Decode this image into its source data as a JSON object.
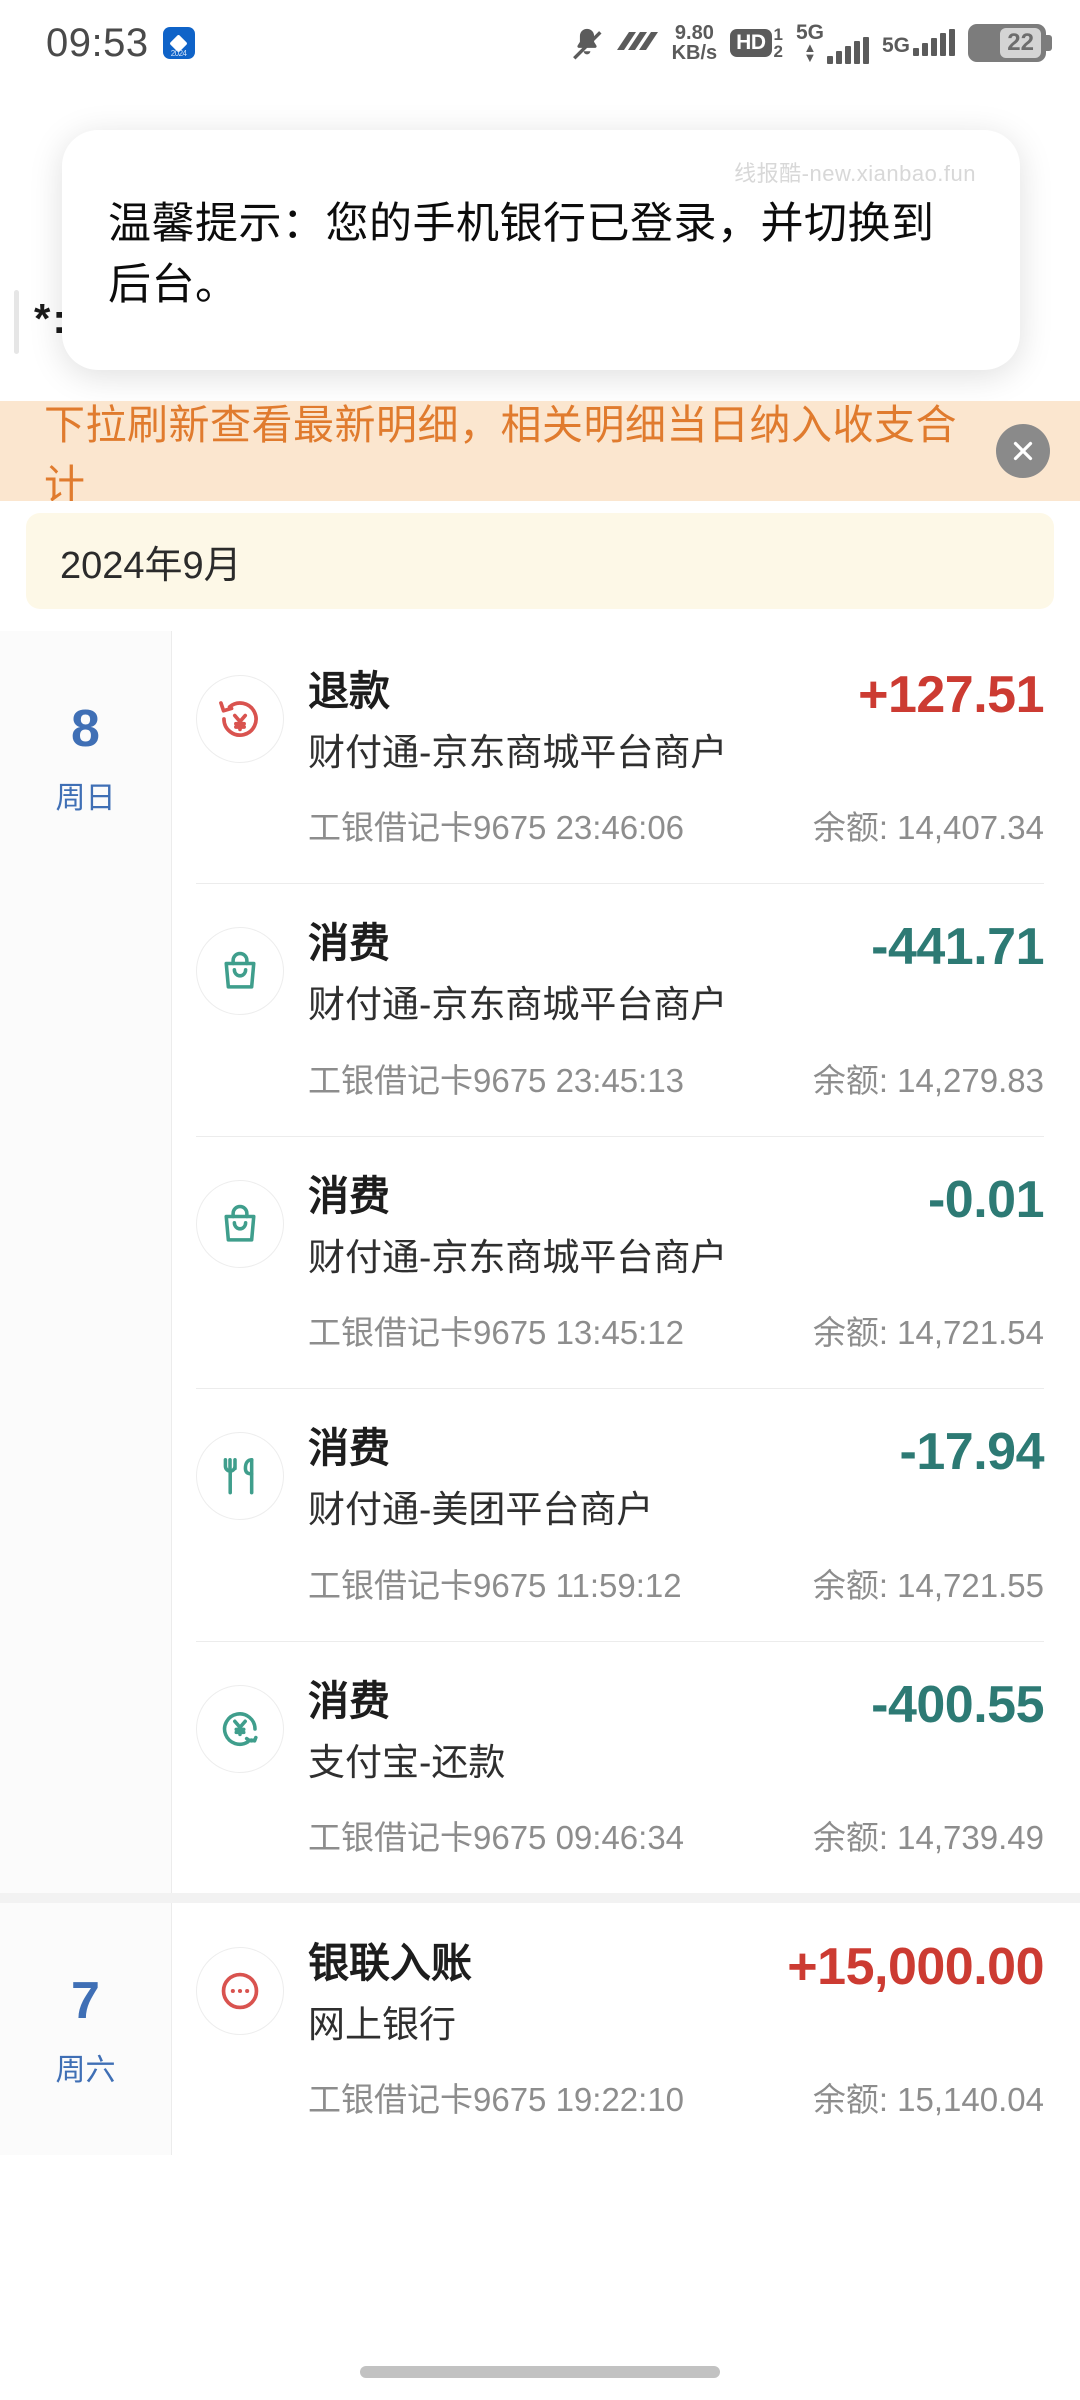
{
  "status_bar": {
    "clock": "09:53",
    "app_badge_label": "2024",
    "network_speed_value": "9.80",
    "network_speed_unit": "KB/s",
    "hd_label": "HD",
    "sim_slot_top": "1",
    "sim_slot_bottom": "2",
    "network_type_sim1": "5G",
    "network_type_sim2": "5G",
    "battery_percent": "22",
    "icons": [
      "mute-bell-icon",
      "vpn-arrows-icon",
      "hd-icon",
      "signal-icon",
      "signal-icon",
      "battery-icon"
    ]
  },
  "background_header": {
    "masked_text": "*:"
  },
  "toast": {
    "message": "温馨提示：您的手机银行已登录，并切换到后台。",
    "watermark": "线报酷-new.xianbao.fun"
  },
  "notice": {
    "text": "下拉刷新查看最新明细，相关明细当日纳入收支合计",
    "close_icon": "close-icon",
    "background_color": "#fbe6cf",
    "text_color": "#e07b2e"
  },
  "month_header": {
    "label": "2024年9月",
    "background_color": "#fdf8e7"
  },
  "colors": {
    "income": "#cc3b32",
    "expense": "#2d7a74",
    "date": "#3f6fb5"
  },
  "days": [
    {
      "day_number": "8",
      "weekday": "周日",
      "transactions": [
        {
          "icon": "refund-yen-icon",
          "icon_color": "#d9534f",
          "title": "退款",
          "merchant": "财付通-京东商城平台商户",
          "card": "工银借记卡9675",
          "time": "23:46:06",
          "amount": "+127.51",
          "direction": "in",
          "balance_label": "余额:",
          "balance": "14,407.34"
        },
        {
          "icon": "shopping-bag-icon",
          "icon_color": "#3f9e8c",
          "title": "消费",
          "merchant": "财付通-京东商城平台商户",
          "card": "工银借记卡9675",
          "time": "23:45:13",
          "amount": "-441.71",
          "direction": "out",
          "balance_label": "余额:",
          "balance": "14,279.83"
        },
        {
          "icon": "shopping-bag-icon",
          "icon_color": "#3f9e8c",
          "title": "消费",
          "merchant": "财付通-京东商城平台商户",
          "card": "工银借记卡9675",
          "time": "13:45:12",
          "amount": "-0.01",
          "direction": "out",
          "balance_label": "余额:",
          "balance": "14,721.54"
        },
        {
          "icon": "restaurant-icon",
          "icon_color": "#3f9e8c",
          "title": "消费",
          "merchant": "财付通-美团平台商户",
          "card": "工银借记卡9675",
          "time": "11:59:12",
          "amount": "-17.94",
          "direction": "out",
          "balance_label": "余额:",
          "balance": "14,721.55"
        },
        {
          "icon": "repayment-yen-icon",
          "icon_color": "#3f9e8c",
          "title": "消费",
          "merchant": "支付宝-还款",
          "card": "工银借记卡9675",
          "time": "09:46:34",
          "amount": "-400.55",
          "direction": "out",
          "balance_label": "余额:",
          "balance": "14,739.49"
        }
      ]
    },
    {
      "day_number": "7",
      "weekday": "周六",
      "transactions": [
        {
          "icon": "unionpay-dots-icon",
          "icon_color": "#d9534f",
          "title": "银联入账",
          "merchant": "网上银行",
          "card": "工银借记卡9675",
          "time": "19:22:10",
          "amount": "+15,000.00",
          "direction": "in",
          "balance_label": "余额:",
          "balance": "15,140.04"
        }
      ]
    }
  ]
}
